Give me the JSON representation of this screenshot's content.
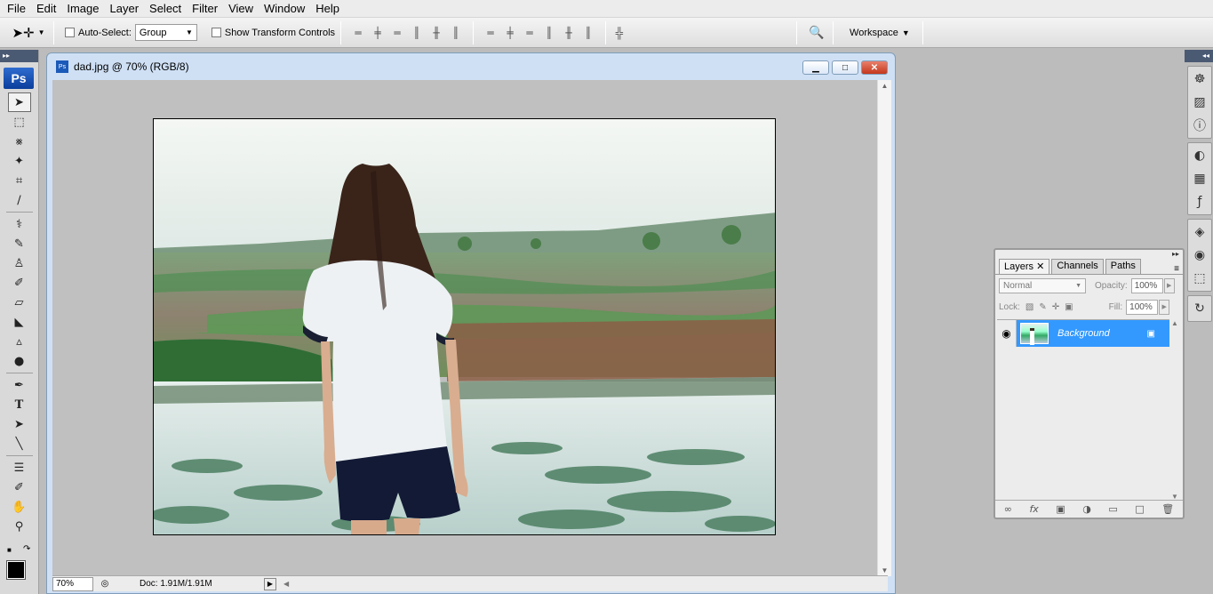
{
  "menu": [
    "File",
    "Edit",
    "Image",
    "Layer",
    "Select",
    "Filter",
    "View",
    "Window",
    "Help"
  ],
  "options": {
    "auto_select_label": "Auto-Select:",
    "auto_select_value": "Group",
    "transform_label": "Show Transform Controls",
    "workspace_label": "Workspace"
  },
  "toolbox": {
    "logo": "Ps"
  },
  "document": {
    "title": "dad.jpg @ 70% (RGB/8)",
    "zoom": "70%",
    "doc_size": "Doc: 1.91M/1.91M"
  },
  "layers_panel": {
    "tabs": [
      "Layers",
      "Channels",
      "Paths"
    ],
    "blend_mode": "Normal",
    "opacity_label": "Opacity:",
    "opacity_value": "100%",
    "lock_label": "Lock:",
    "fill_label": "Fill:",
    "fill_value": "100%",
    "layer_name": "Background"
  },
  "colors": {
    "selection": "#3399ff",
    "foreground": "#000000",
    "background": "#ffffff",
    "photo_sky": "#eef3f0",
    "photo_grass": "#3f7f45",
    "photo_water": "#d9e8ea"
  }
}
